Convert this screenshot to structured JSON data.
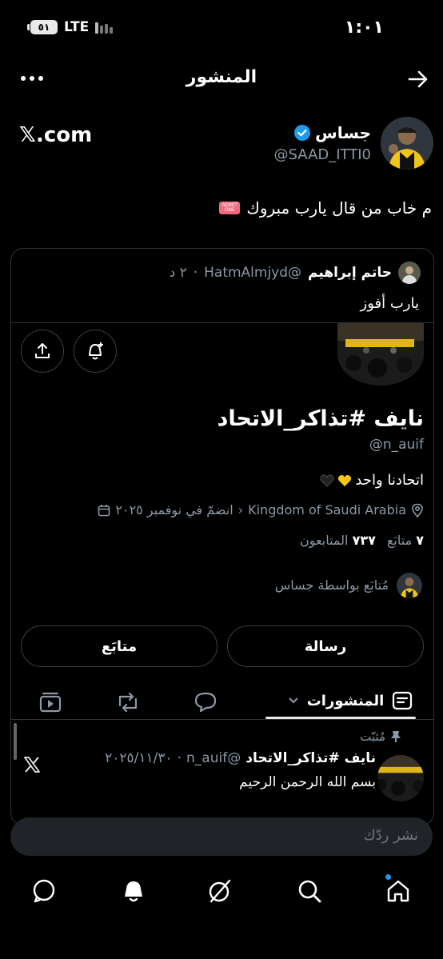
{
  "status": {
    "time": "١:٠١",
    "network": "LTE",
    "battery": "٥١"
  },
  "header": {
    "title": "المنشور",
    "back_icon": "arrow-right-icon",
    "more_icon": "more-horizontal-icon"
  },
  "author": {
    "name": "جساس",
    "handle": "@SAAD_ITTI0",
    "verified": true,
    "watermark": "𝕏.com"
  },
  "post": {
    "text": "م خاب من قال يارب مبروك",
    "ticket_emoji": "ADMIT ONE"
  },
  "quote": {
    "name": "حاتم إبراهيم",
    "handle": "@HatmAlmjyd",
    "time": "٢ د",
    "separator": "·",
    "text": "يارب أفوز",
    "profile": {
      "name": "نايف #تذاكر_الاتحاد",
      "handle": "@n_auif",
      "bio": "اتحادنا واحد",
      "location": "Kingdom of Saudi Arabia",
      "joined": "انضمّ في نوفمبر ٢٠٢٥",
      "following_count": "٧",
      "following_label": "متابَع",
      "followers_count": "٧٣٧",
      "followers_label": "المتابعون",
      "followed_by": "مُتابَع بواسطة جساس",
      "message_button": "رسالة",
      "follow_button": "متابَع",
      "tabs": {
        "posts_label": "المنشورات"
      },
      "pinned_label": "مُثبّت",
      "pinned_post": {
        "name": "نايف #تذاكر_الاتحاد",
        "handle": "@n_auif",
        "date": "٢٠٢٥/١١/٣٠",
        "text": "بسم الله الرحمن الرحيم"
      }
    }
  },
  "reply_bar": {
    "placeholder": "نشر ردّك"
  },
  "nav": {
    "items": [
      "home-icon",
      "search-icon",
      "grok-icon",
      "notifications-icon",
      "messages-icon"
    ]
  },
  "colors": {
    "accent": "#1d9bf0",
    "background": "#000000",
    "muted": "#8b98a5"
  }
}
